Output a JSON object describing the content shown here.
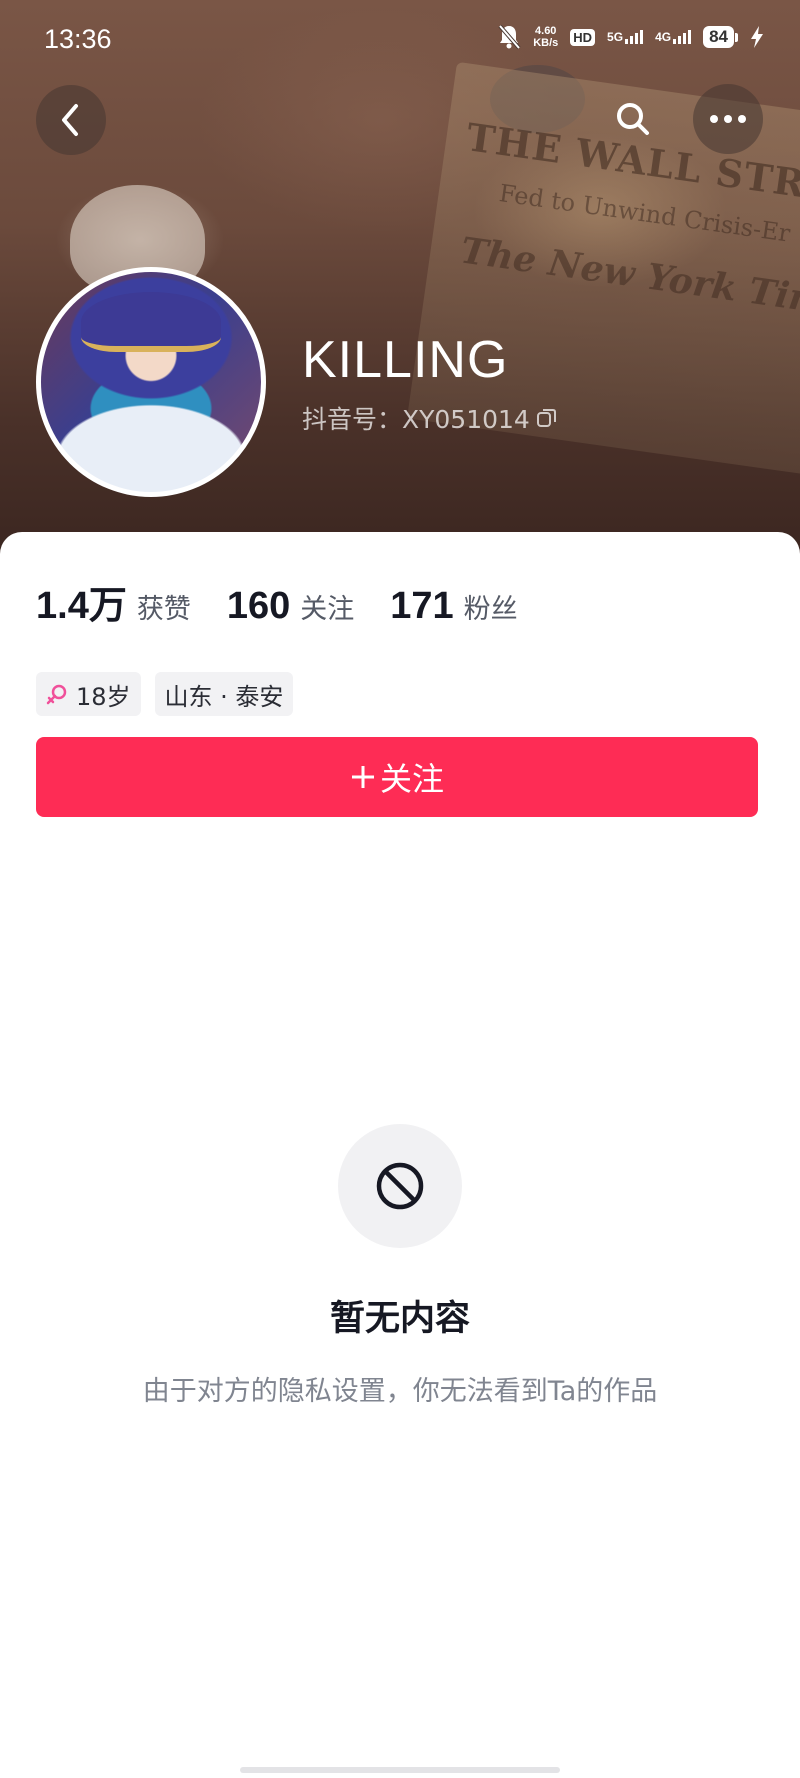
{
  "status_bar": {
    "time": "13:36",
    "network_speed": "4.60",
    "network_speed_unit": "KB/s",
    "hd_label": "HD",
    "sim1_network": "5G",
    "sim2_network": "4G",
    "battery_level": "84"
  },
  "profile": {
    "name": "KILLING",
    "douyin_id": "抖音号：XY051014"
  },
  "stats": [
    {
      "value": "1.4万",
      "label": "获赞"
    },
    {
      "value": "160",
      "label": "关注"
    },
    {
      "value": "171",
      "label": "粉丝"
    }
  ],
  "tags": {
    "age": "18岁",
    "location": "山东 · 泰安"
  },
  "follow_button": {
    "label": "关注",
    "color": "#fe2c55"
  },
  "empty_state": {
    "title": "暂无内容",
    "description": "由于对方的隐私设置，你无法看到Ta的作品"
  },
  "background_text": {
    "headline1": "THE WALL STREET JO",
    "headline2": "Fed to Unwind Crisis-Er",
    "headline3": "The New York Times"
  }
}
